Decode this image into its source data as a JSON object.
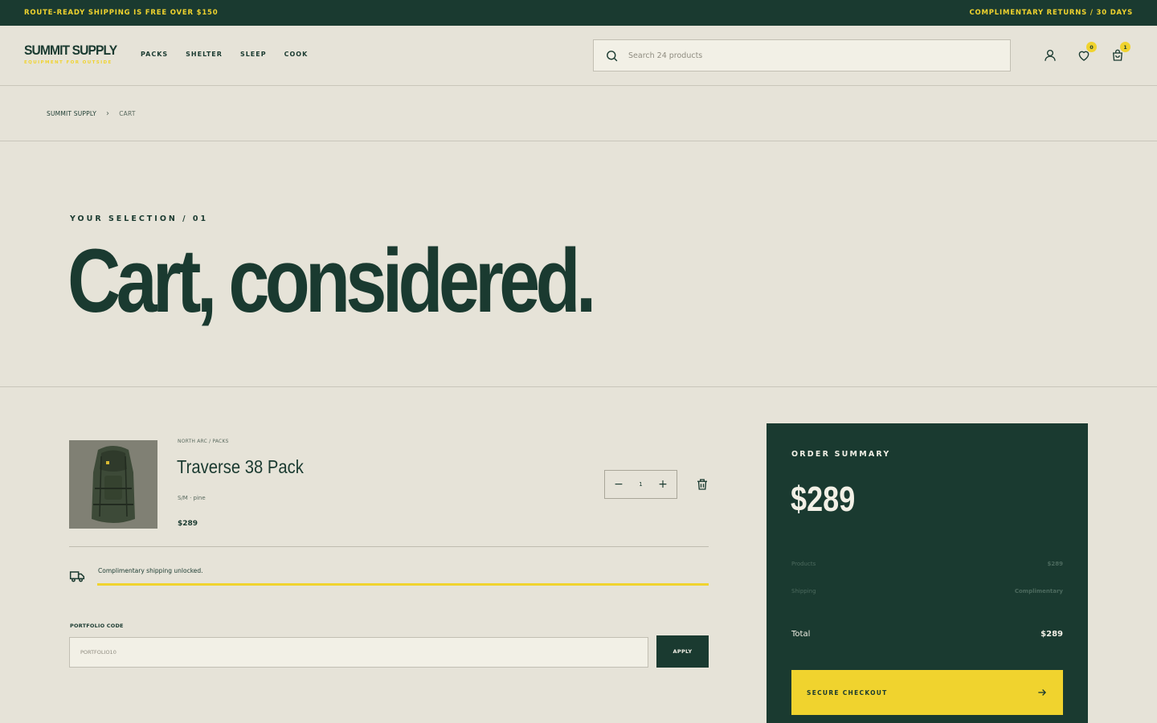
{
  "colors": {
    "primary": "#1a3a30",
    "accent": "#f0d32e",
    "background": "#e6e3d8",
    "surface": "#f2f0e6"
  },
  "announcement": {
    "left": "ROUTE-READY SHIPPING IS FREE OVER $150",
    "right": "COMPLIMENTARY RETURNS / 30 DAYS"
  },
  "brand": {
    "name": "SUMMIT SUPPLY",
    "tagline": "EQUIPMENT FOR OUTSIDE"
  },
  "nav": [
    {
      "label": "PACKS"
    },
    {
      "label": "SHELTER"
    },
    {
      "label": "SLEEP"
    },
    {
      "label": "COOK"
    }
  ],
  "search": {
    "placeholder": "Search 24 products",
    "icon": "search-icon"
  },
  "header_icons": {
    "account": {
      "icon": "user-icon"
    },
    "wishlist": {
      "icon": "heart-icon",
      "count": "0"
    },
    "cart": {
      "icon": "bag-icon",
      "count": "1"
    }
  },
  "breadcrumb": {
    "home": "SUMMIT SUPPLY",
    "current": "CART",
    "separator": "›"
  },
  "hero": {
    "eyebrow": "YOUR SELECTION / 01",
    "title": "Cart, considered."
  },
  "cart": {
    "items": [
      {
        "meta": "NORTH ARC / PACKS",
        "name": "Traverse 38 Pack",
        "variant": "S/M · pine",
        "price": "$289",
        "quantity": "1"
      }
    ],
    "shipping_message": "Complimentary shipping unlocked.",
    "shipping_progress": 1.0,
    "promo": {
      "label": "PORTFOLIO CODE",
      "placeholder": "PORTFOLIO10",
      "button": "APPLY"
    }
  },
  "summary": {
    "title": "ORDER SUMMARY",
    "big_total": "$289",
    "products_label": "Products",
    "products_value": "$289",
    "shipping_label": "Shipping",
    "shipping_value": "Complimentary",
    "total_label": "Total",
    "total_value": "$289",
    "checkout_label": "SECURE CHECKOUT"
  }
}
